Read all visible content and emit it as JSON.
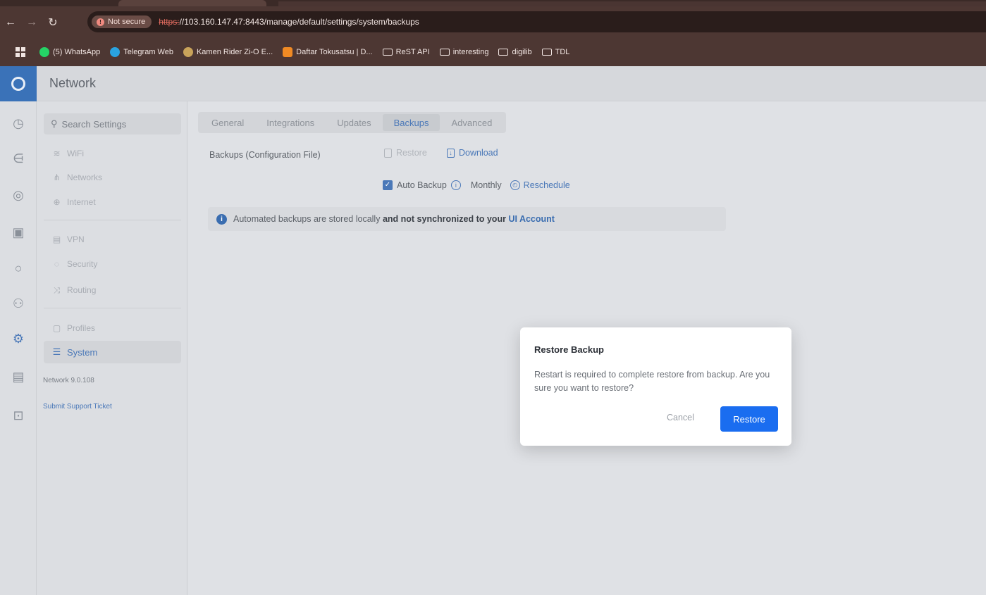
{
  "browser": {
    "security_label": "Not secure",
    "url_scheme": "https:",
    "url_rest": "//103.160.147.47:8443/manage/default/settings/system/backups",
    "bookmarks": [
      {
        "label": "(5) WhatsApp",
        "icon": "whatsapp-icon",
        "color": "#25d366"
      },
      {
        "label": "Telegram Web",
        "icon": "telegram-icon",
        "color": "#2aa3e0"
      },
      {
        "label": "Kamen Rider Zi-O E...",
        "icon": "kamen-rider-icon",
        "color": "#c9a35a"
      },
      {
        "label": "Daftar Tokusatsu | D...",
        "icon": "blogger-icon",
        "color": "#f08a24"
      },
      {
        "label": "ReST API",
        "icon": "folder-icon"
      },
      {
        "label": "interesting",
        "icon": "folder-icon"
      },
      {
        "label": "digilib",
        "icon": "folder-icon"
      },
      {
        "label": "TDL",
        "icon": "folder-icon"
      }
    ]
  },
  "app": {
    "title": "Network"
  },
  "sidebar": {
    "search_placeholder": "Search Settings",
    "items": [
      {
        "label": "WiFi"
      },
      {
        "label": "Networks"
      },
      {
        "label": "Internet"
      },
      {
        "label": "VPN"
      },
      {
        "label": "Security"
      },
      {
        "label": "Routing"
      },
      {
        "label": "Profiles"
      },
      {
        "label": "System"
      }
    ],
    "version": "Network 9.0.108",
    "support_link": "Submit Support Ticket"
  },
  "tabs": [
    {
      "label": "General"
    },
    {
      "label": "Integrations"
    },
    {
      "label": "Updates"
    },
    {
      "label": "Backups"
    },
    {
      "label": "Advanced"
    }
  ],
  "backups": {
    "row_label": "Backups (Configuration File)",
    "restore_label": "Restore",
    "download_label": "Download",
    "auto_backup_label": "Auto Backup",
    "frequency": "Monthly",
    "reschedule_label": "Reschedule",
    "notice_text": "Automated backups are stored locally",
    "notice_bold": "and not synchronized to your",
    "notice_link": "UI Account"
  },
  "modal": {
    "title": "Restore Backup",
    "body": "Restart is required to complete restore from backup. Are you sure you want to restore?",
    "cancel_label": "Cancel",
    "confirm_label": "Restore"
  },
  "colors": {
    "accent": "#1a6df0",
    "link": "#4a78b8"
  }
}
